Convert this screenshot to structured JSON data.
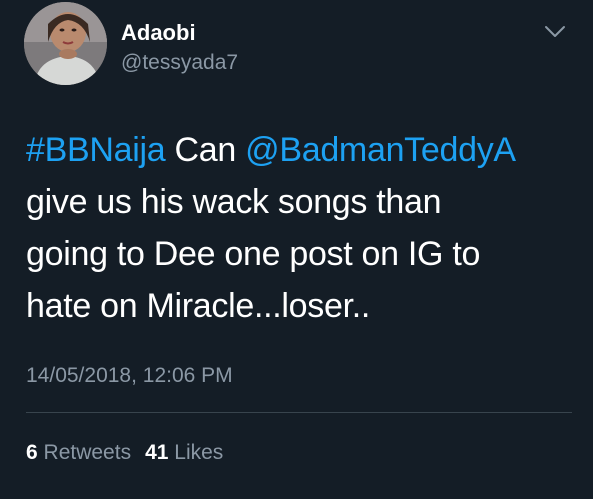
{
  "author": {
    "display_name": "Adaobi",
    "handle": "@tessyada7",
    "avatar_icon": "user-avatar-photo"
  },
  "menu": {
    "icon": "chevron-down-icon"
  },
  "tweet": {
    "hashtag": "#BBNaija",
    "text_1": " Can ",
    "mention": "@BadmanTeddyA",
    "line_2": "give us his wack songs than",
    "line_3": "going to Dee one post on IG to",
    "line_4": "hate on Miracle...loser.."
  },
  "timestamp": "14/05/2018, 12:06 PM",
  "stats": {
    "retweets_count": "6",
    "retweets_label": "Retweets",
    "likes_count": "41",
    "likes_label": "Likes"
  },
  "colors": {
    "background": "#141d26",
    "link": "#1da1f2",
    "secondary_text": "#8b98a5",
    "divider": "#38444d"
  }
}
